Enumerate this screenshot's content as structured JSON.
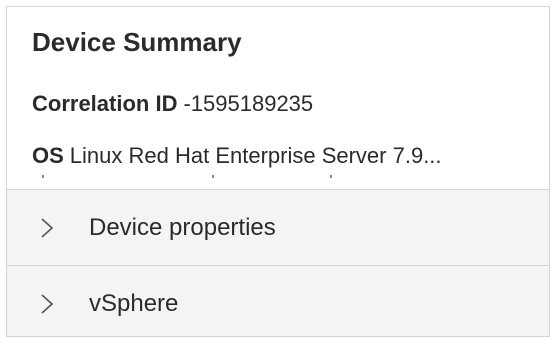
{
  "summary": {
    "title": "Device Summary",
    "correlation": {
      "label": "Correlation ID",
      "value": "-1595189235"
    },
    "os": {
      "label": "OS",
      "value": "Linux Red Hat Enterprise Server 7.9..."
    }
  },
  "sections": [
    {
      "label": "Device properties",
      "icon": "chevron-right-icon",
      "expanded": false
    },
    {
      "label": "vSphere",
      "icon": "chevron-right-icon",
      "expanded": false
    }
  ],
  "colors": {
    "section_background": "#f4f4f4",
    "border": "#d4d4d4",
    "text": "#2b2b2b"
  }
}
